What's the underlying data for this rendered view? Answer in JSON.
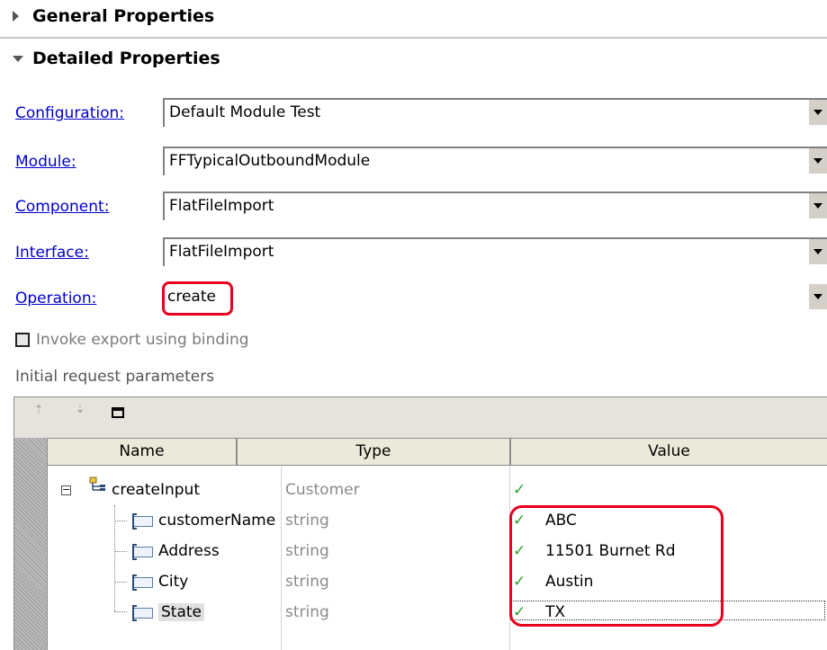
{
  "sections": {
    "general": "General Properties",
    "detailed": "Detailed Properties"
  },
  "properties": [
    {
      "label": "Configuration:",
      "value": "Default Module Test"
    },
    {
      "label": "Module:",
      "value": "FFTypicalOutboundModule"
    },
    {
      "label": "Component:",
      "value": "FlatFileImport"
    },
    {
      "label": "Interface:",
      "value": "FlatFileImport"
    },
    {
      "label": "Operation:",
      "value": "create"
    }
  ],
  "invoke_checkbox": {
    "label": "Invoke export using binding",
    "checked": false
  },
  "params_caption": "Initial request parameters",
  "table": {
    "columns": [
      "Name",
      "Type",
      "Value"
    ],
    "rows": [
      {
        "name": "createInput",
        "type": "Customer",
        "value": "",
        "icon": "business-object-icon",
        "expanded": true
      },
      {
        "name": "customerName",
        "type": "string",
        "value": "ABC",
        "icon": "field-icon"
      },
      {
        "name": "Address",
        "type": "string",
        "value": "11501 Burnet Rd",
        "icon": "field-icon"
      },
      {
        "name": "City",
        "type": "string",
        "value": "Austin",
        "icon": "field-icon"
      },
      {
        "name": "State",
        "type": "string",
        "value": "TX",
        "icon": "field-icon"
      }
    ],
    "check_glyph": "✓"
  },
  "colors": {
    "highlight": "#e8001c",
    "link": "#0000cc",
    "check": "#2ca02c"
  }
}
